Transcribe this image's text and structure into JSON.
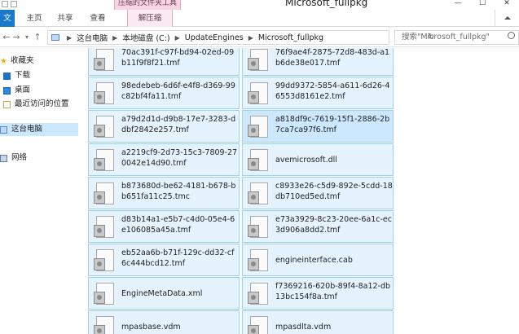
{
  "window": {
    "title": "Microsoft_fullpkg",
    "context_group": "压缩的文件夹工具",
    "controls": [
      "—",
      "☐",
      "✕"
    ]
  },
  "ribbon": {
    "tabs": [
      {
        "label": "文件"
      },
      {
        "label": "主页"
      },
      {
        "label": "共享"
      },
      {
        "label": "查看"
      },
      {
        "label": "解压缩"
      }
    ]
  },
  "navigation": {
    "back": "←",
    "forward": "→",
    "recent": "▾",
    "up": "↑",
    "breadcrumbs": [
      "这台电脑",
      "本地磁盘 (C:)",
      "UpdateEngines",
      "Microsoft_fullpkg"
    ],
    "refresh_icon": "↻",
    "search_placeholder": "搜索\"Microsoft_fullpkg\""
  },
  "sidebar": {
    "items": [
      {
        "label": "收藏夹",
        "icon": "star-icon"
      },
      {
        "label": "下载",
        "icon": "download-folder-icon"
      },
      {
        "label": "桌面",
        "icon": "desktop-icon"
      },
      {
        "label": "最近访问的位置",
        "icon": "recent-places-icon"
      },
      {
        "label": "这台电脑",
        "icon": "computer-icon",
        "selected": true
      },
      {
        "label": "网络",
        "icon": "network-icon"
      }
    ]
  },
  "files": [
    {
      "name": "70ac391f-c97f-bd94-02ed-09b11f9f8f21.tmf",
      "highlight": false
    },
    {
      "name": "76f9ae4f-2875-72d8-483d-a1b6de38e017.tmf",
      "highlight": false
    },
    {
      "name": "98edebeb-6d6f-e4f8-d369-99c82bf4fa11.tmf",
      "highlight": false
    },
    {
      "name": "99dd9372-5854-a611-6d26-46553d8161e2.tmf",
      "highlight": false
    },
    {
      "name": "a79d2d1d-d9b8-17e7-3283-ddbf2842e257.tmf",
      "highlight": false
    },
    {
      "name": "a818df9c-7619-15f1-2886-2b7ca7ca97f6.tmf",
      "highlight": true
    },
    {
      "name": "a2219cf9-2d73-15c3-7809-270042e14d90.tmf",
      "highlight": false
    },
    {
      "name": "avemicrosoft.dll",
      "highlight": false
    },
    {
      "name": "b873680d-be62-4181-b678-bb651fa11c25.tmc",
      "highlight": false
    },
    {
      "name": "c8933e26-c5d9-892e-5cdd-18db710ed5ed.tmf",
      "highlight": false
    },
    {
      "name": "d83b14a1-e5b7-c4d0-05e4-6e106085a45a.tmf",
      "highlight": false
    },
    {
      "name": "e73a3929-8c23-20ee-6a1c-ec3d906a8dd2.tmf",
      "highlight": false
    },
    {
      "name": "eb52aa6b-b71f-129c-dd32-cf6c444bcd12.tmf",
      "highlight": false
    },
    {
      "name": "engineinterface.cab",
      "highlight": false
    },
    {
      "name": "EngineMetaData.xml",
      "highlight": false
    },
    {
      "name": "f7369216-620b-89f4-8a12-db13bc154f8a.tmf",
      "highlight": false
    },
    {
      "name": "mpasbase.vdm",
      "highlight": false
    },
    {
      "name": "mpasdlta.vdm",
      "highlight": false
    }
  ]
}
